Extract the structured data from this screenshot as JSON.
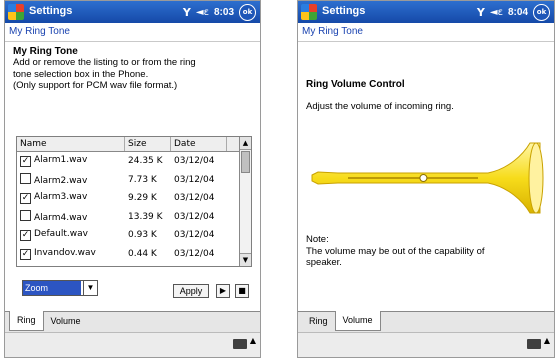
{
  "status": {
    "signal": "Y",
    "speaker": "◄ε",
    "ok": "ok"
  },
  "left": {
    "app_title": "Settings",
    "clock": "8:03",
    "page_title": "My Ring Tone",
    "heading": "My Ring Tone",
    "desc_lines": [
      "Add or remove the listing to or from the ring",
      "tone selection box in the Phone.",
      "(Only support for PCM wav file format.)"
    ],
    "columns": [
      "Name",
      "Size",
      "Date"
    ],
    "rows": [
      {
        "checked": true,
        "name": "Alarm1.wav",
        "size": "24.35 K",
        "date": "03/12/04"
      },
      {
        "checked": false,
        "name": "Alarm2.wav",
        "size": "7.73 K",
        "date": "03/12/04"
      },
      {
        "checked": true,
        "name": "Alarm3.wav",
        "size": "9.29 K",
        "date": "03/12/04"
      },
      {
        "checked": false,
        "name": "Alarm4.wav",
        "size": "13.39 K",
        "date": "03/12/04"
      },
      {
        "checked": true,
        "name": "Default.wav",
        "size": "0.93 K",
        "date": "03/12/04"
      },
      {
        "checked": true,
        "name": "Invandov.wav",
        "size": "0.44 K",
        "date": "03/12/04"
      }
    ],
    "combo_value": "Zoom",
    "apply_label": "Apply",
    "tabs": [
      "Ring",
      "Volume"
    ],
    "active_tab": 0
  },
  "right": {
    "app_title": "Settings",
    "clock": "8:04",
    "page_title": "My Ring Tone",
    "heading": "Ring Volume Control",
    "desc": "Adjust the volume of incoming ring.",
    "note_label": "Note:",
    "note_lines": [
      "The volume may be out of the capability of",
      "speaker."
    ],
    "volume_level": 0.58,
    "tabs": [
      "Ring",
      "Volume"
    ],
    "active_tab": 1
  },
  "colors": {
    "title_bar": "#1d56b8",
    "page_title": "#1a43b0",
    "trumpet": "#f7dc1b"
  }
}
